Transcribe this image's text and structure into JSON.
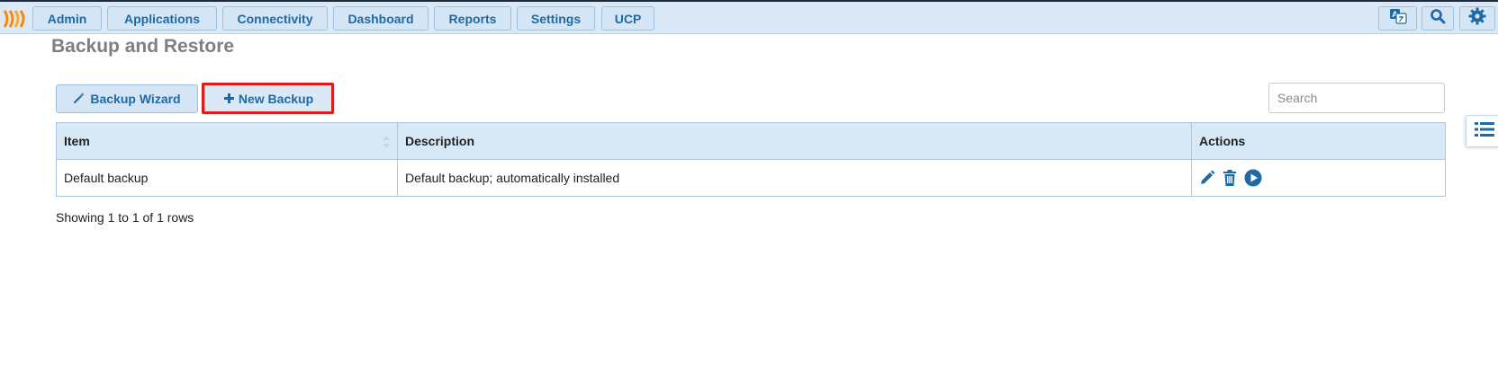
{
  "nav": {
    "items": [
      {
        "label": "Admin"
      },
      {
        "label": "Applications"
      },
      {
        "label": "Connectivity"
      },
      {
        "label": "Dashboard"
      },
      {
        "label": "Reports"
      },
      {
        "label": "Settings"
      },
      {
        "label": "UCP"
      }
    ],
    "icons": [
      "language-icon",
      "search-icon",
      "gear-icon"
    ]
  },
  "page": {
    "title": "Backup and Restore"
  },
  "toolbar": {
    "wizard_label": "Backup Wizard",
    "new_backup_label": "New Backup",
    "search_placeholder": "Search"
  },
  "table": {
    "headers": [
      "Item",
      "Description",
      "Actions"
    ],
    "rows": [
      {
        "item": "Default backup",
        "description": "Default backup; automatically installed"
      }
    ],
    "row_actions": [
      "edit-icon",
      "delete-icon",
      "run-icon"
    ]
  },
  "footer": {
    "pagination_text": "Showing 1 to 1 of 1 rows"
  },
  "colors": {
    "accent": "#1f6aa5",
    "nav_bg": "#dbe9f6",
    "highlight": "#e01b1b",
    "logo": "#f28a12"
  }
}
